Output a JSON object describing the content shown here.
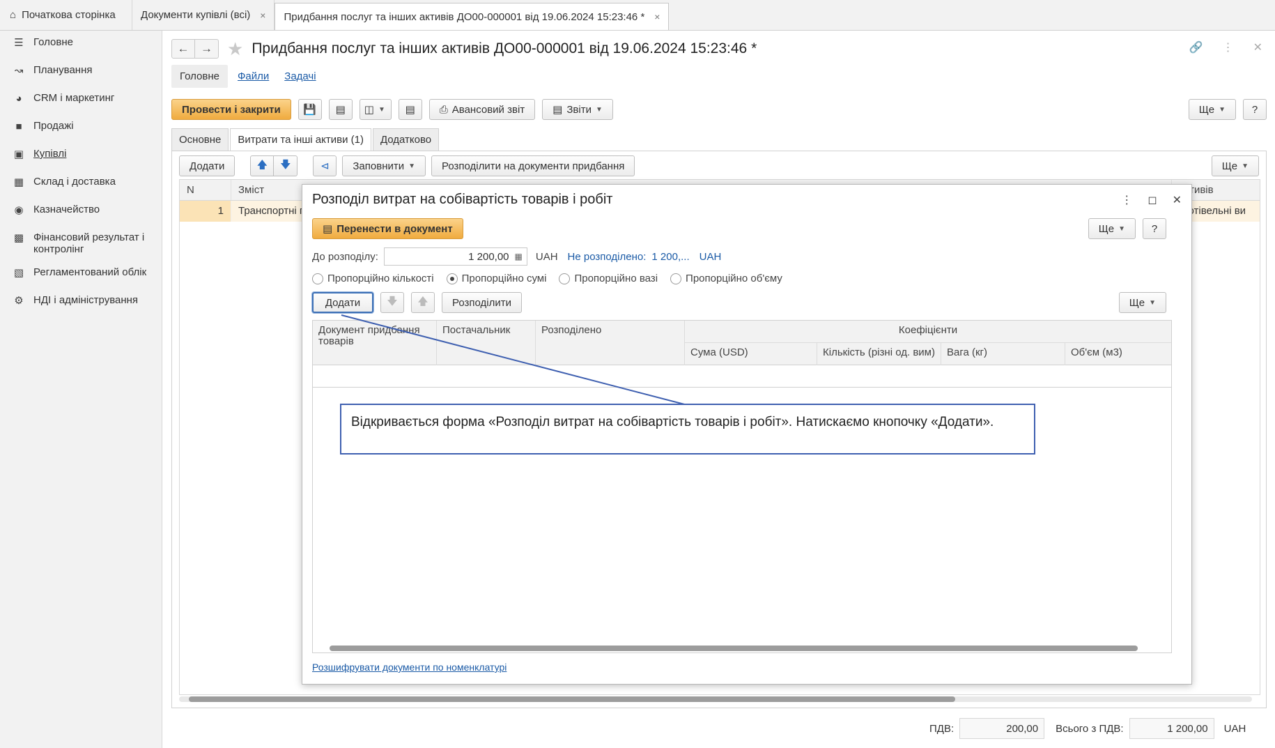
{
  "top_tabs": [
    {
      "label": "Початкова сторінка"
    },
    {
      "label": "Документи купівлі (всі)",
      "close": "×"
    },
    {
      "label": "Придбання послуг та інших активів ДО00-000001 від 19.06.2024 15:23:46 *",
      "close": "×"
    }
  ],
  "sidebar": {
    "items": [
      {
        "label": "Головне",
        "icon": "menu-icon"
      },
      {
        "label": "Планування",
        "icon": "chart-line-icon"
      },
      {
        "label": "CRM і маркетинг",
        "icon": "pie-icon"
      },
      {
        "label": "Продажі",
        "icon": "bag-icon"
      },
      {
        "label": "Купівлі",
        "icon": "cart-icon"
      },
      {
        "label": "Склад і доставка",
        "icon": "grid-icon"
      },
      {
        "label": "Казначейство",
        "icon": "coin-icon"
      },
      {
        "label": "Фінансовий результат і контролінг",
        "icon": "bar-chart-icon"
      },
      {
        "label": "Регламентований облік",
        "icon": "doc-icon"
      },
      {
        "label": "НДІ і адміністрування",
        "icon": "gear-icon"
      }
    ]
  },
  "document": {
    "title": "Придбання послуг та інших активів ДО00-000001 від 19.06.2024 15:23:46 *",
    "subnav": {
      "current": "Головне",
      "files": "Файли",
      "tasks": "Задачі"
    },
    "toolbar": {
      "post_close": "Провести і закрити",
      "advance_report": "Авансовий звіт",
      "reports": "Звіти",
      "more": "Ще",
      "help": "?"
    },
    "tabs": [
      "Основне",
      "Витрати та інші активи (1)",
      "Додатково"
    ],
    "panel_toolbar": {
      "add": "Додати",
      "fill": "Заповнити",
      "distribute": "Розподілити на документи придбання",
      "more": "Ще"
    },
    "grid": {
      "headers": [
        "N",
        "Зміст",
        "активів"
      ],
      "row": {
        "n": "1",
        "content": "Транспортні г",
        "tail": "аготівельні ви"
      }
    },
    "footer": {
      "vat_label": "ПДВ:",
      "vat": "200,00",
      "total_label": "Всього з ПДВ:",
      "total": "1 200,00",
      "currency": "UAH"
    }
  },
  "modal": {
    "title": "Розподіл витрат на собівартість товарів і робіт",
    "transfer": "Перенести в документ",
    "more": "Ще",
    "help": "?",
    "to_distribute_label": "До розподілу:",
    "to_distribute_value": "1 200,00",
    "currency": "UAH",
    "not_distributed_label": "Не розподілено:",
    "not_distributed_value": "1 200,...",
    "not_distributed_currency": "UAH",
    "radios": [
      {
        "label": "Пропорційно кількості",
        "selected": false
      },
      {
        "label": "Пропорційно сумі",
        "selected": true
      },
      {
        "label": "Пропорційно вазі",
        "selected": false
      },
      {
        "label": "Пропорційно об'єму",
        "selected": false
      }
    ],
    "toolbar": {
      "add": "Додати",
      "distribute": "Розподілити",
      "more": "Ще"
    },
    "grid_headers": {
      "doc": "Документ придбання товарів",
      "supplier": "Постачальник",
      "distributed": "Розподілено",
      "coef": "Коефіцієнти",
      "sum": "Сума (USD)",
      "qty": "Кількість (різні од. вим)",
      "weight": "Вага (кг)",
      "volume": "Об'єм (м3)"
    },
    "decode_link": "Розшифрувати документи по номенклатурі"
  },
  "annotation": {
    "text": "Відкривається форма «Розподіл витрат на собівартість товарів і робіт». Натискаємо кнопочку «Додати».",
    "color": "#3e5fb0"
  },
  "colors": {
    "accent": "#f0ab3f",
    "link": "#1a5aa6",
    "row_highlight": "#fdf3e1"
  }
}
